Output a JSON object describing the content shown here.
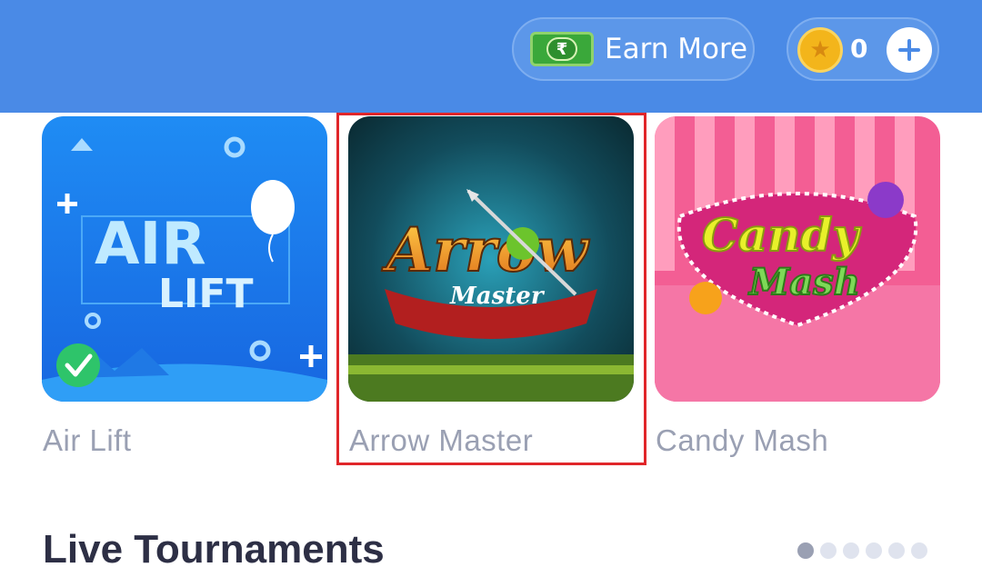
{
  "header": {
    "earn_more_label": "Earn More",
    "cash_symbol": "₹",
    "coin_count": "0",
    "add_symbol": "+"
  },
  "games": [
    {
      "title": "Air Lift",
      "art_text_1": "AIR",
      "art_text_2": "LIFT",
      "verified": true
    },
    {
      "title": "Arrow Master",
      "art_text_1": "Arrow",
      "art_text_2": "Master",
      "highlighted": true
    },
    {
      "title": "Candy Mash",
      "art_text_1": "Candy",
      "art_text_2": "Mash"
    }
  ],
  "section": {
    "title": "Live Tournaments",
    "page_count": 6,
    "active_page": 1
  },
  "colors": {
    "header_bg": "#4a8ae6",
    "title_gray": "#9aa0b3",
    "highlight_red": "#e0262a",
    "section_title": "#2d2f45"
  }
}
